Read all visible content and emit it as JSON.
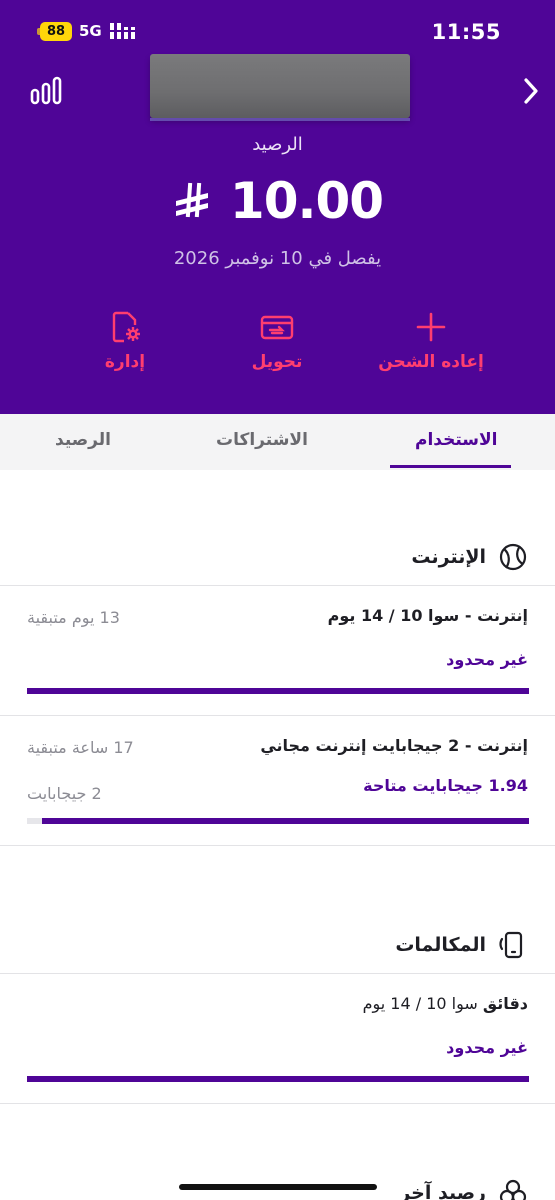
{
  "status_bar": {
    "battery": "88",
    "network": "5G",
    "time": "11:55",
    "icons": [
      "battery-icon",
      "signal-icon"
    ]
  },
  "header": {
    "left_icon": "stats-icon",
    "right_icon": "chevron-right-icon",
    "balance_label": "الرصيد",
    "balance_amount": "10.00",
    "currency_icon": "riyal-icon",
    "expiry": "يفصل في 10 نوفمبر 2026",
    "background": "#4f0597"
  },
  "actions": [
    {
      "label": "إدارة",
      "icon": "manage-gear-icon"
    },
    {
      "label": "تحويل",
      "icon": "transfer-card-icon"
    },
    {
      "label": "إعاده الشحن",
      "icon": "plus-icon"
    }
  ],
  "tabs": [
    {
      "label": "الاستخدام",
      "active": true
    },
    {
      "label": "الاشتراكات",
      "active": false
    },
    {
      "label": "الرصيد",
      "active": false
    }
  ],
  "internet": {
    "title": "الإنترنت",
    "icon": "globe-icon",
    "items": [
      {
        "title": "إنترنت - سوا 10 / 14 يوم",
        "remaining": "13 يوم متبقية",
        "status": "غير محدود",
        "progress": 1.0
      },
      {
        "title": "إنترنت - 2 جيجابايت إنترنت مجاني",
        "remaining": "17 ساعة متبقية",
        "status": "1.94 جيجابايت متاحة",
        "total": "2 جيجابايت",
        "progress": 0.97
      }
    ]
  },
  "calls": {
    "title": "المكالمات",
    "icon": "phone-icon",
    "items": [
      {
        "title_bold": "دقائق",
        "title_rest": " سوا 10 / 14 يوم",
        "status": "غير محدود",
        "progress": 1.0
      }
    ]
  },
  "other": {
    "title": "رصيد آخر",
    "icon": "other-balance-icon"
  },
  "colors": {
    "accent": "#4f0597",
    "action": "#ff3e6f",
    "muted": "#8c8c94"
  }
}
